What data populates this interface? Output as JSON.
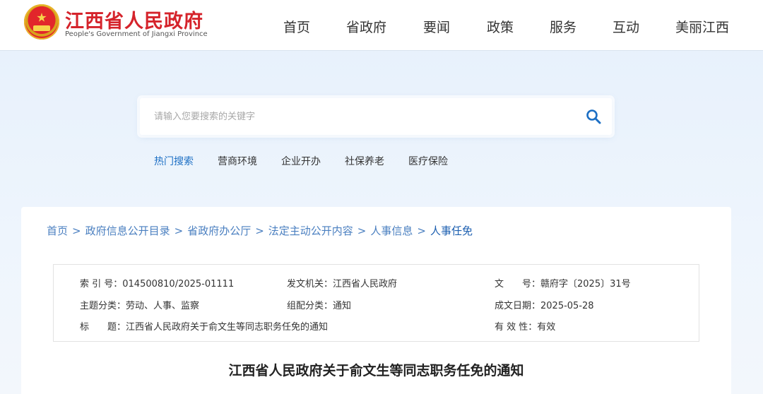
{
  "header": {
    "title": "江西省人民政府",
    "subtitle": "People's Government of Jiangxi Province",
    "emblem_icon": "national-emblem-icon",
    "brand_color": "#d5232b"
  },
  "nav": {
    "items": [
      "首页",
      "省政府",
      "要闻",
      "政策",
      "服务",
      "互动",
      "美丽江西"
    ]
  },
  "search": {
    "placeholder": "请输入您要搜索的关键字",
    "value": "",
    "icon": "search-icon",
    "accent": "#1c6fc4"
  },
  "hot_search": {
    "items": [
      "热门搜索",
      "营商环境",
      "企业开办",
      "社保养老",
      "医疗保险"
    ]
  },
  "breadcrumb": {
    "items": [
      "首页",
      "政府信息公开目录",
      "省政府办公厅",
      "法定主动公开内容",
      "人事信息",
      "人事任免"
    ],
    "separator": ">"
  },
  "meta": {
    "index_label": "索 引 号：",
    "index_value": "014500810/2025-01111",
    "issuer_label": "发文机关：",
    "issuer_value": "江西省人民政府",
    "docno_label": "文　　号：",
    "docno_value": "赣府字〔2025〕31号",
    "topic_label": "主题分类：",
    "topic_value": "劳动、人事、监察",
    "category_label": "组配分类：",
    "category_value": "通知",
    "date_label": "成文日期：",
    "date_value": "2025-05-28",
    "title_label": "标　　题：",
    "title_value": "江西省人民政府关于俞文生等同志职务任免的通知",
    "validity_label": "有 效 性：",
    "validity_value": "有效"
  },
  "document": {
    "title": "江西省人民政府关于俞文生等同志职务任免的通知"
  }
}
